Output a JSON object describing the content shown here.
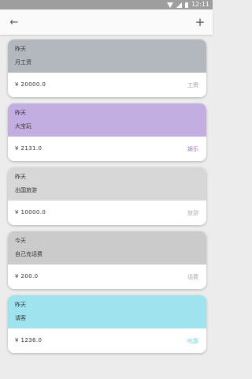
{
  "status_bar": {
    "time": "12:11"
  },
  "app_bar": {
    "back_icon": "←",
    "add_icon": "+"
  },
  "records": [
    {
      "date": "昨天",
      "name": "月工资",
      "amount": "¥ 20000.0",
      "tag": "工资",
      "color": "#b3b7be",
      "tag_color": "#9a9a9a"
    },
    {
      "date": "昨天",
      "name": "大宝玩",
      "amount": "¥ 2131.0",
      "tag": "娱乐",
      "color": "#c2aee0",
      "tag_color": "#9a78c8"
    },
    {
      "date": "昨天",
      "name": "出国旅游",
      "amount": "¥ 10000.0",
      "tag": "旅游",
      "color": "#d7d7d7",
      "tag_color": "#b0b0b0"
    },
    {
      "date": "今天",
      "name": "自己充话费",
      "amount": "¥ 200.0",
      "tag": "话费",
      "color": "#cbcbcb",
      "tag_color": "#a8a8a8"
    },
    {
      "date": "昨天",
      "name": "请客",
      "amount": "¥ 1236.0",
      "tag": "吃饭",
      "color": "#9fe3ee",
      "tag_color": "#6ccfdf"
    }
  ]
}
